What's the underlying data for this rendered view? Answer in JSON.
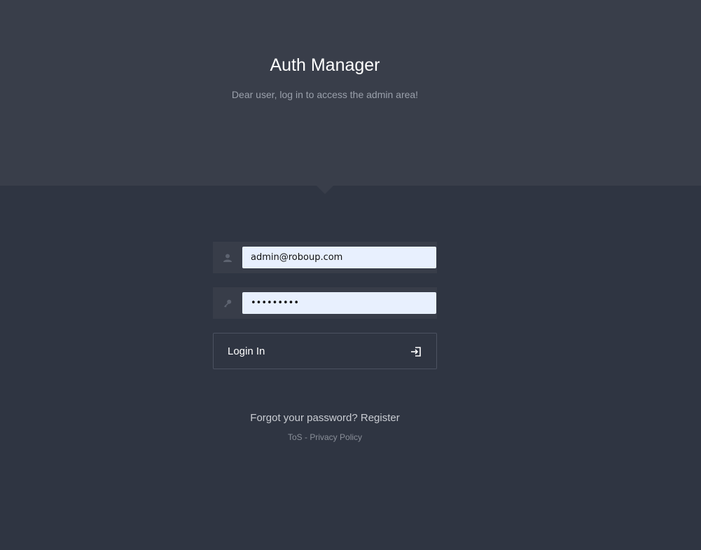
{
  "header": {
    "title": "Auth Manager",
    "subtitle": "Dear user, log in to access the admin area!"
  },
  "form": {
    "email": {
      "value": "admin@roboup.com",
      "icon": "user-icon"
    },
    "password": {
      "value": "•••••••••",
      "icon": "key-icon"
    },
    "login_button": {
      "label": "Login In",
      "icon": "login-icon"
    }
  },
  "links": {
    "forgot_password": "Forgot your password?",
    "register": "Register",
    "tos": "ToS",
    "separator": "-",
    "privacy_policy": "Privacy Policy"
  },
  "colors": {
    "hero_bg": "#393e4a",
    "page_bg": "#2f3542",
    "input_bg": "#e8f0fe"
  }
}
